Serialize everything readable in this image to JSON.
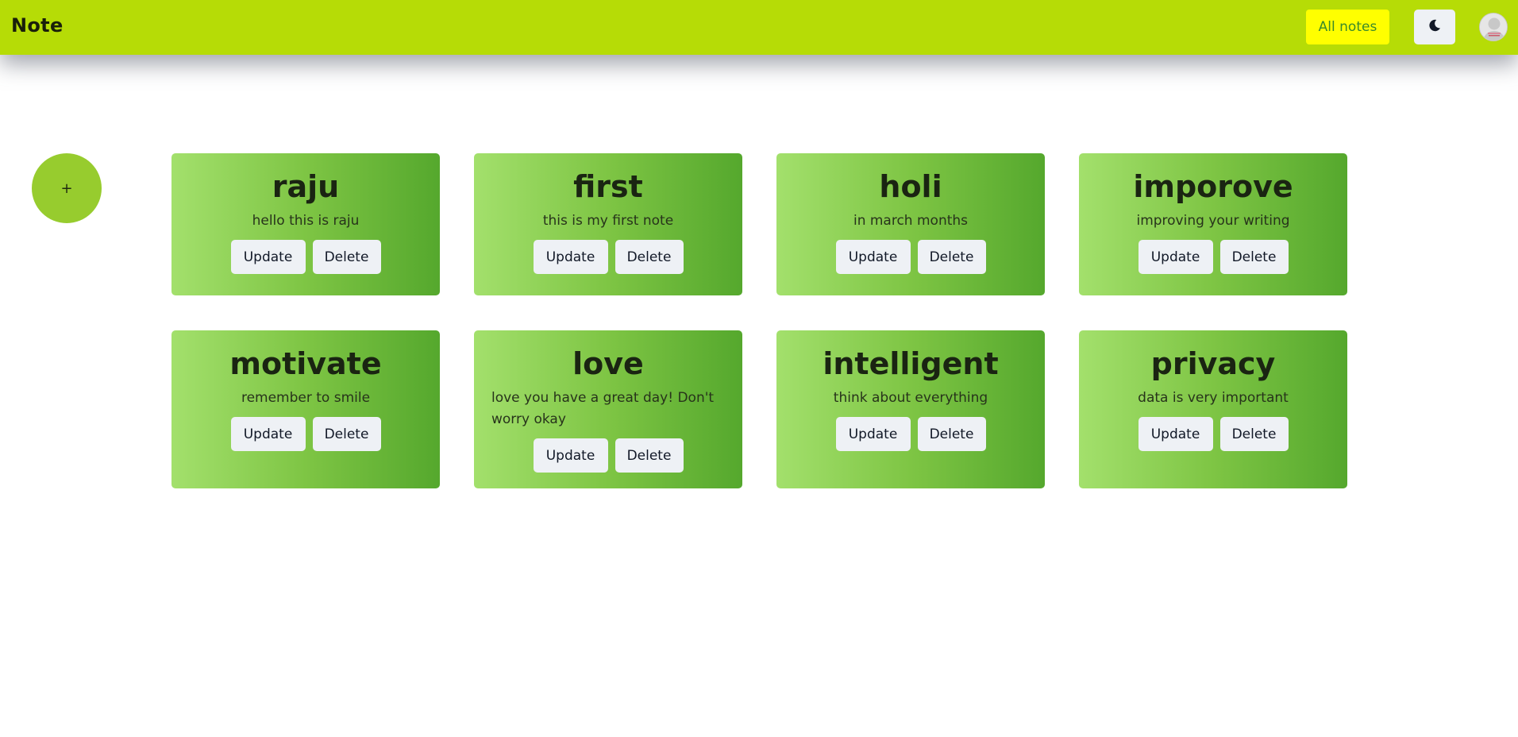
{
  "header": {
    "brand": "Note",
    "all_notes_label": "All notes",
    "theme_icon": "moon-icon",
    "avatar_icon": "user-avatar"
  },
  "add_button": {
    "label": "+"
  },
  "notes": [
    {
      "title": "raju",
      "text": "hello this is raju",
      "update_label": "Update",
      "delete_label": "Delete"
    },
    {
      "title": "first",
      "text": "this is my first note",
      "update_label": "Update",
      "delete_label": "Delete"
    },
    {
      "title": "holi",
      "text": "in march months",
      "update_label": "Update",
      "delete_label": "Delete"
    },
    {
      "title": "imporove",
      "text": "improving your writing",
      "update_label": "Update",
      "delete_label": "Delete"
    },
    {
      "title": "motivate",
      "text": "remember to smile",
      "update_label": "Update",
      "delete_label": "Delete"
    },
    {
      "title": "love",
      "text": "love you have a great day! Don't worry okay",
      "update_label": "Update",
      "delete_label": "Delete"
    },
    {
      "title": "intelligent",
      "text": "think about everything",
      "update_label": "Update",
      "delete_label": "Delete"
    },
    {
      "title": "privacy",
      "text": "data is very important",
      "update_label": "Update",
      "delete_label": "Delete"
    }
  ],
  "colors": {
    "navbar": "#b6dc06",
    "all_notes_bg": "#ffff00",
    "add_button": "#97cc2e",
    "card_gradient_start": "#a3e06c",
    "card_gradient_end": "#55a82d",
    "button_bg": "#eef1f5"
  }
}
